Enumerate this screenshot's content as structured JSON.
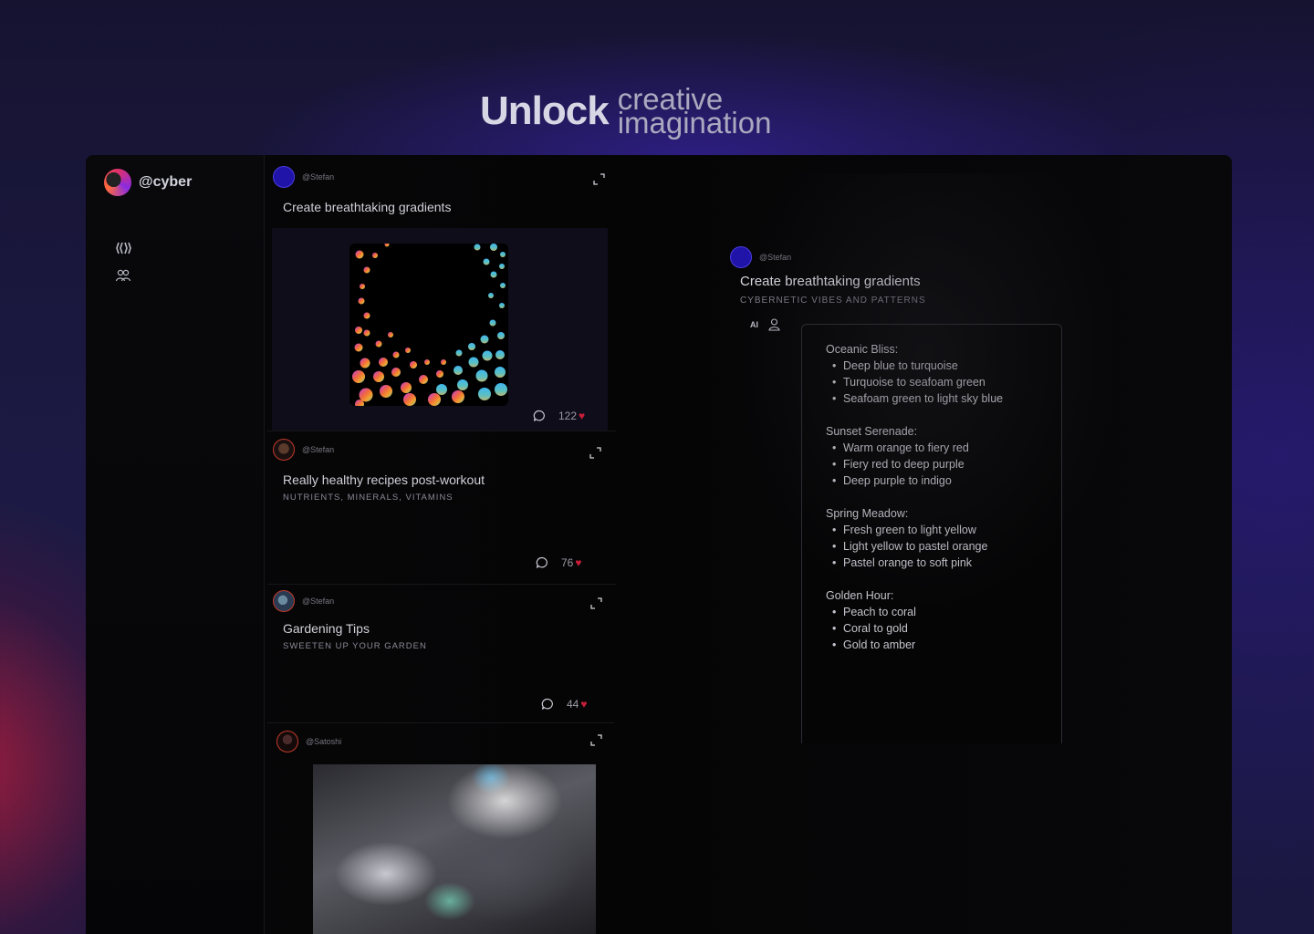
{
  "hero": {
    "bold": "Unlock",
    "line1": "creative",
    "line2": "imagination"
  },
  "profile": {
    "handle": "@cyber"
  },
  "feed": [
    {
      "user": "@Stefan",
      "title": "Create breathtaking gradients",
      "subtitle": "",
      "comments_icon": "chat-bubble-icon",
      "likes": "122"
    },
    {
      "user": "@Stefan",
      "title": "Really healthy recipes post-workout",
      "subtitle": "NUTRIENTS, MINERALS, VITAMINS",
      "likes": "76"
    },
    {
      "user": "@Stefan",
      "title": "Gardening Tips",
      "subtitle": "SWEETEN UP YOUR GARDEN",
      "likes": "44"
    },
    {
      "user": "@Satoshi",
      "title": "",
      "subtitle": ""
    }
  ],
  "detail": {
    "user": "@Stefan",
    "title": "Create breathtaking gradients",
    "subtitle": "CYBERNETIC VIBES AND PATTERNS",
    "ai_label": "AI",
    "groups": [
      {
        "title": "Oceanic Bliss:",
        "items": [
          "Deep blue to turquoise",
          "Turquoise to seafoam green",
          "Seafoam green to light sky blue"
        ]
      },
      {
        "title": "Sunset Serenade:",
        "items": [
          "Warm orange to fiery red",
          "Fiery red to deep purple",
          "Deep purple to indigo"
        ]
      },
      {
        "title": "Spring Meadow:",
        "items": [
          "Fresh green to light yellow",
          "Light yellow to pastel orange",
          "Pastel orange to soft pink"
        ]
      },
      {
        "title": "Golden Hour:",
        "items": [
          "Peach to coral",
          "Coral to gold",
          "Gold to amber"
        ]
      }
    ]
  },
  "colors": {
    "accent": "#2d1fb0",
    "heart": "#c81e3a"
  }
}
